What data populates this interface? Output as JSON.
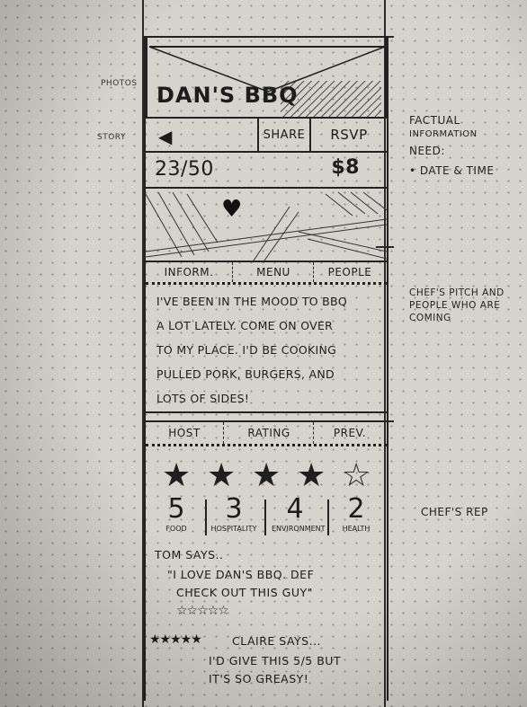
{
  "side_labels": {
    "photos": "Photos",
    "story": "Story"
  },
  "header": {
    "title": "DAN'S BBQ"
  },
  "actions": {
    "back_icon": "back-arrow-icon",
    "share": "SHARE",
    "rsvp": "RSVP"
  },
  "stats": {
    "attendance": "23/50",
    "price": "$8"
  },
  "tabs_top": [
    "INFORM.",
    "MENU",
    "PEOPLE"
  ],
  "pitch": {
    "lines": [
      "I'VE BEEN IN THE MOOD TO BBQ",
      "A LOT LATELY. COME ON OVER",
      "TO MY PLACE. I'D BE COOKING",
      "PULLED PORK, BURGERS, AND",
      "LOTS OF SIDES!"
    ]
  },
  "tabs_bottom": [
    "HOST",
    "RATING",
    "PREV."
  ],
  "ratings": [
    {
      "value": "5",
      "label": "FOOD"
    },
    {
      "value": "3",
      "label": "HOSPITALITY"
    },
    {
      "value": "4",
      "label": "ENVIRONMENT"
    },
    {
      "value": "2",
      "label": "HEALTH"
    }
  ],
  "reviews": [
    {
      "author": "TOM SAYS..",
      "text_1": "\"I LOVE DAN'S BBQ. DEF",
      "text_2": "CHECK OUT THIS GUY\"",
      "stars": "☆☆☆☆☆"
    },
    {
      "author": "CLAIRE SAYS...",
      "text_1": "I'D GIVE THIS 5/5 BUT",
      "text_2": "IT'S SO GREASY!",
      "stars": "★★★★★"
    }
  ],
  "annotations": {
    "factual_1": "FACTUAL",
    "factual_2": "INFORMATION",
    "need": "NEED:",
    "date_time": "• DATE & TIME",
    "pitch_1": "CHEF'S PITCH AND",
    "pitch_2": "PEOPLE WHO ARE",
    "pitch_3": "COMING",
    "rep": "CHEF'S REP"
  }
}
